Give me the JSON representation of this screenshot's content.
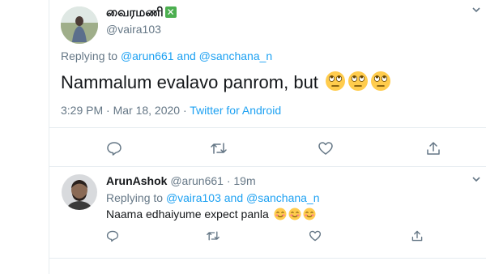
{
  "main_tweet": {
    "display_name": "வைரமணி",
    "name_badge": "✕",
    "handle": "@vaira103",
    "replying_to_prefix": "Replying to",
    "reply_user_1": "@arun661",
    "reply_and": "and",
    "reply_user_2": "@sanchana_n",
    "text": "Nammalum evalavo panrom, but",
    "emoji": [
      "rolling-eyes",
      "rolling-eyes",
      "rolling-eyes"
    ],
    "timestamp": "3:29 PM · Mar 18, 2020 ·",
    "source": "Twitter for Android"
  },
  "reply_tweet": {
    "display_name": "ArunAshok",
    "handle_time": "@arun661 · 19m",
    "replying_to_prefix": "Replying to",
    "reply_user_1": "@vaira103",
    "reply_and": "and",
    "reply_user_2": "@sanchana_n",
    "text": "Naama edhaiyume expect panla",
    "emoji": [
      "smiling",
      "smiling",
      "smiling"
    ]
  },
  "colors": {
    "accent": "#1da1f2",
    "muted": "#657786",
    "divider": "#e6ecf0"
  },
  "icons": [
    "chevron-down",
    "reply",
    "retweet",
    "like",
    "share"
  ]
}
